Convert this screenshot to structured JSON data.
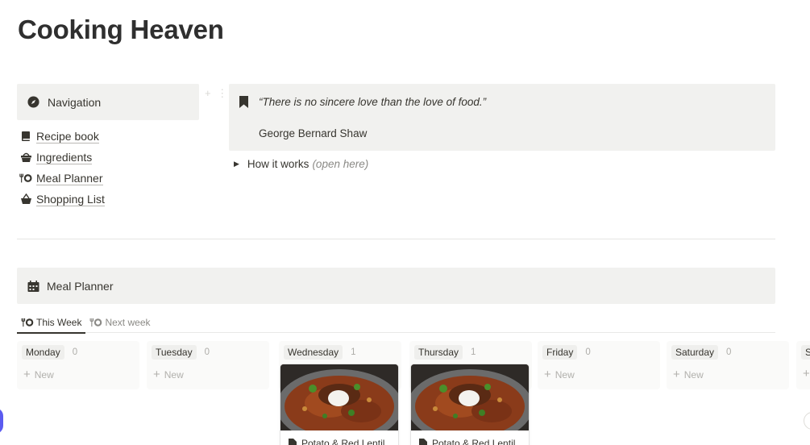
{
  "page": {
    "title": "Cooking Heaven"
  },
  "navigation": {
    "heading": "Navigation",
    "heading_icon": "compass-icon",
    "links": [
      {
        "label": "Recipe book",
        "icon": "book-icon"
      },
      {
        "label": "Ingredients",
        "icon": "basket-icon"
      },
      {
        "label": "Meal Planner",
        "icon": "fork-plate-icon"
      },
      {
        "label": "Shopping List",
        "icon": "shopping-basket-icon"
      }
    ]
  },
  "quote": {
    "icon": "bookmark-icon",
    "text": "“There is no sincere love than the love of food.”",
    "author": "George Bernard Shaw"
  },
  "toggle": {
    "label": "How it works",
    "hint": "(open here)"
  },
  "planner": {
    "heading": "Meal Planner",
    "heading_icon": "calendar-icon",
    "tabs": [
      {
        "label": "This Week",
        "active": true
      },
      {
        "label": "Next week",
        "active": false
      }
    ],
    "new_label": "New",
    "columns": [
      {
        "day": "Monday",
        "count": "0"
      },
      {
        "day": "Tuesday",
        "count": "0"
      },
      {
        "day": "Wednesday",
        "count": "1",
        "card": "Potato & Red Lentil"
      },
      {
        "day": "Thursday",
        "count": "1",
        "card": "Potato & Red Lentil"
      },
      {
        "day": "Friday",
        "count": "0"
      },
      {
        "day": "Saturday",
        "count": "0"
      },
      {
        "day": "S",
        "count": ""
      }
    ]
  },
  "colors": {
    "accent": "#5b5bf0",
    "callout_bg": "#f1f1ef",
    "text": "#37352f",
    "muted": "#8b8a86"
  }
}
